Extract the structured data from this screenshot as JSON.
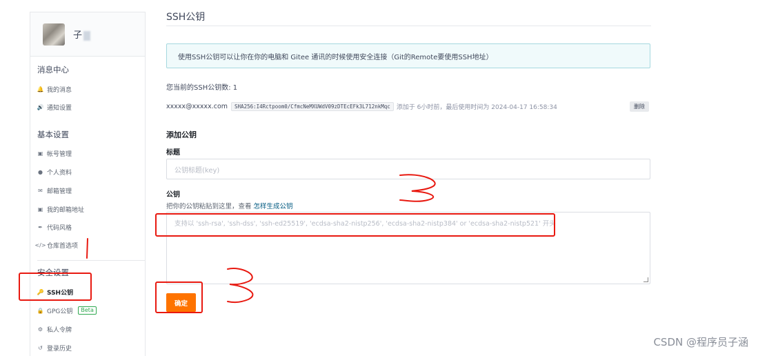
{
  "sidebar": {
    "username": "子",
    "groups": {
      "messages": {
        "title": "消息中心",
        "items": [
          "我的消息",
          "通知设置"
        ]
      },
      "basic": {
        "title": "基本设置",
        "items": [
          "帐号管理",
          "个人资料",
          "邮箱管理",
          "我的邮箱地址",
          "代码风格",
          "仓库首选项"
        ]
      },
      "security": {
        "title": "安全设置",
        "items": [
          "SSH公钥",
          "GPG公钥",
          "私人令牌",
          "登录历史"
        ],
        "beta_label": "Beta"
      }
    },
    "icons": {
      "my_messages": "bell-icon",
      "notify": "speaker-icon",
      "account": "id-card-icon",
      "profile": "person-icon",
      "email": "envelope-icon",
      "my_email": "id-card-icon",
      "code_style": "brush-icon",
      "repo_pref": "code-icon",
      "ssh": "key-icon",
      "gpg": "lock-icon",
      "token": "token-icon",
      "history": "history-icon"
    }
  },
  "main": {
    "title": "SSH公钥",
    "info": "使用SSH公钥可以让你在你的电脑和 Gitee 通讯的时候使用安全连接（Git的Remote要使用SSH地址）",
    "key_count": "您当前的SSH公钥数: 1",
    "key": {
      "email": "xxxxx@xxxxx.com",
      "fingerprint": "SHA256:I4Rctpoom0/CfmcNeMXUWdV09zDTEcEFk3L712nkMqc",
      "meta": "添加于 6小时前，最后使用时间为 2024-04-17 16:58:34",
      "delete_label": "删除"
    },
    "add_heading": "添加公钥",
    "title_label": "标题",
    "title_placeholder": "公钥标题(key)",
    "pubkey_label": "公钥",
    "hint_text": "把你的公钥粘贴到这里，查看 ",
    "hint_link": "怎样生成公钥",
    "textarea_placeholder": "支持以 'ssh-rsa', 'ssh-dss', 'ssh-ed25519', 'ecdsa-sha2-nistp256', 'ecdsa-sha2-nistp384' or 'ecdsa-sha2-nistp521' 开头",
    "submit_label": "确定"
  },
  "watermark": "CSDN @程序员子涵",
  "colors": {
    "accent": "#fe7300",
    "annotation": "#e8180f",
    "info_bg": "#f0fafb",
    "link": "#005980"
  }
}
